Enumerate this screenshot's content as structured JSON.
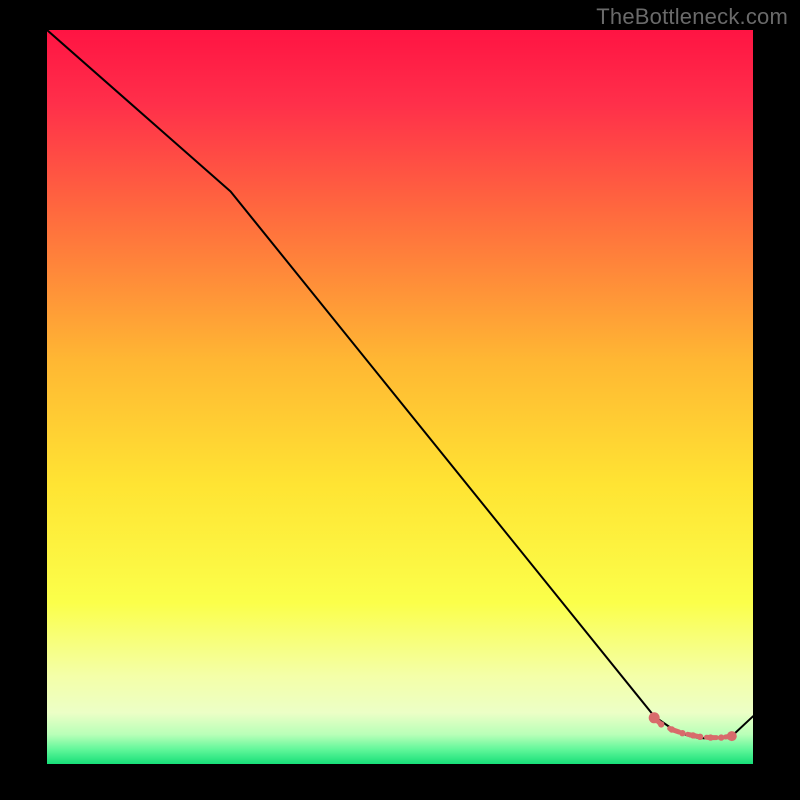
{
  "watermark": "TheBottleneck.com",
  "colors": {
    "bg_black": "#000000",
    "gradient_top": "#ff1a4b",
    "gradient_mid1": "#ff8a2a",
    "gradient_mid2": "#ffe92a",
    "gradient_low": "#f7ffb0",
    "gradient_bottom": "#1fe37a",
    "line": "#000000",
    "marker": "#d86b6b",
    "watermark": "#6a6a6a"
  },
  "chart_data": {
    "type": "line",
    "title": "",
    "xlabel": "",
    "ylabel": "",
    "xlim": [
      0,
      100
    ],
    "ylim": [
      0,
      100
    ],
    "grid": false,
    "legend": false,
    "annotations": [
      "TheBottleneck.com"
    ],
    "series": [
      {
        "name": "curve",
        "x": [
          0,
          26,
          86,
          89,
          91,
          92,
          93,
          95,
          97,
          100
        ],
        "y": [
          100,
          78,
          6.5,
          4.5,
          3.8,
          3.6,
          3.5,
          3.5,
          3.8,
          6.5
        ]
      }
    ],
    "markers": {
      "name": "highlight",
      "x": [
        86,
        87,
        88.5,
        90,
        91.5,
        92.5,
        94,
        95.5,
        97
      ],
      "y": [
        6.3,
        5.4,
        4.7,
        4.2,
        3.9,
        3.7,
        3.6,
        3.6,
        3.8
      ]
    }
  }
}
